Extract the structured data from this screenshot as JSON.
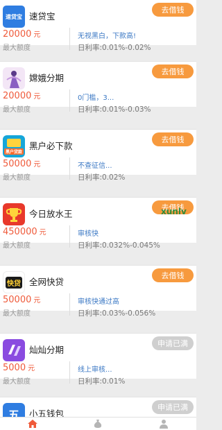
{
  "colors": {
    "accent": "#f79a3e",
    "amount": "#ef5a3a",
    "tag": "#3b78c4",
    "disabled": "#cfcfcf"
  },
  "products": [
    {
      "name": "速贷宝",
      "amount": "20000",
      "unit": "元",
      "amount_label": "最大额度",
      "tag": "无视黑白，下款高!",
      "rate": "日利率:0.01%-0.02%",
      "button": "去借钱",
      "button_state": "active",
      "logo_icon": "sudaibao-logo-icon",
      "logo_text": "速贷宝"
    },
    {
      "name": "嫦娥分期",
      "amount": "20000",
      "unit": "元",
      "amount_label": "最大额度",
      "tag": "0门槛，3...",
      "rate": "日利率:0.01%-0.03%",
      "button": "去借钱",
      "button_state": "active",
      "logo_icon": "change-goddess-logo-icon",
      "logo_text": ""
    },
    {
      "name": "黑户必下款",
      "amount": "50000",
      "unit": "元",
      "amount_label": "最大额度",
      "tag": "不查征信...",
      "rate": "日利率:0.02%",
      "button": "去借钱",
      "button_state": "active",
      "logo_icon": "heihu-logo-icon",
      "logo_text": "黑户贷款"
    },
    {
      "name": "今日放水王",
      "amount": "450000",
      "unit": "元",
      "amount_label": "最大额度",
      "tag": "审核快",
      "rate": "日利率:0.032%-0.045%",
      "button": "去借钱",
      "button_state": "active",
      "logo_icon": "trophy-logo-icon",
      "logo_text": ""
    },
    {
      "name": "全网快贷",
      "amount": "50000",
      "unit": "元",
      "amount_label": "最大额度",
      "tag": "审核快通过高",
      "rate": "日利率:0.03%-0.056%",
      "button": "去借钱",
      "button_state": "active",
      "logo_icon": "kuaidai-logo-icon",
      "logo_text": "快贷"
    },
    {
      "name": "灿灿分期",
      "amount": "5000",
      "unit": "元",
      "amount_label": "最大额度",
      "tag": "线上审核...",
      "rate": "日利率:0.01%",
      "button": "申请已满",
      "button_state": "disabled",
      "logo_icon": "cancan-logo-icon",
      "logo_text": ""
    },
    {
      "name": "小五钱包",
      "amount": "",
      "unit": "",
      "amount_label": "",
      "tag": "",
      "rate": "",
      "button": "申请已满",
      "button_state": "disabled",
      "logo_icon": "xiaowu-logo-icon",
      "logo_text": "五"
    }
  ],
  "watermark": "xunlv",
  "tabbar": [
    {
      "icon": "home-icon",
      "active": true
    },
    {
      "icon": "money-bag-icon",
      "active": false
    },
    {
      "icon": "user-icon",
      "active": false
    }
  ]
}
